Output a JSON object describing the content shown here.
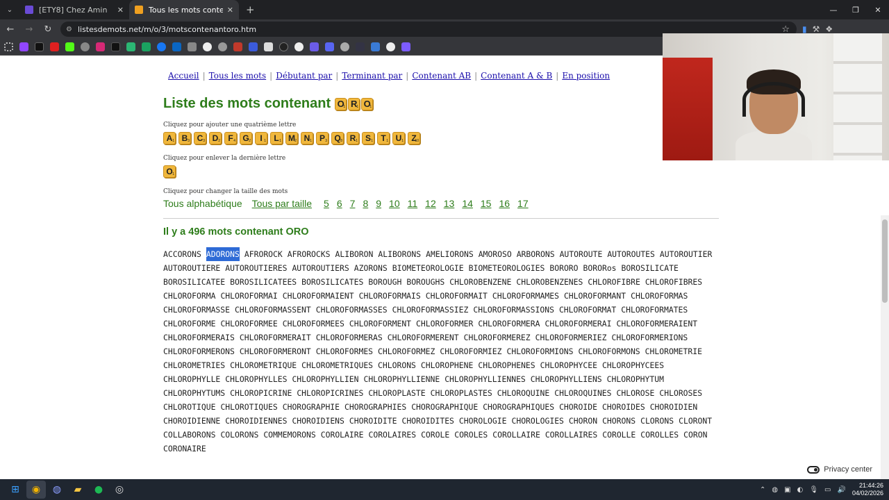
{
  "browser": {
    "tabs": [
      {
        "label": "[ETY8] Chez Amin",
        "color": "#6a4bd6"
      },
      {
        "label": "Tous les mots contenant ORO",
        "color": "#f0a020"
      }
    ],
    "url": "listesdemots.net/m/o/3/motscontenantoro.htm"
  },
  "nav": {
    "items": [
      "Accueil",
      "Tous les mots",
      "Débutant par",
      "Terminant par",
      "Contenant AB",
      "Contenant A & B",
      "En position"
    ]
  },
  "page": {
    "title": "Liste des mots contenant",
    "title_tiles": [
      {
        "l": "O",
        "s": "1"
      },
      {
        "l": "R",
        "s": "1"
      },
      {
        "l": "O",
        "s": "1"
      }
    ],
    "add_hint": "Cliquez pour ajouter une quatrième lettre",
    "add_tiles": [
      {
        "l": "A",
        "s": "1"
      },
      {
        "l": "B",
        "s": "3"
      },
      {
        "l": "C",
        "s": "3"
      },
      {
        "l": "D",
        "s": "2"
      },
      {
        "l": "F",
        "s": "4"
      },
      {
        "l": "G",
        "s": "2"
      },
      {
        "l": "I",
        "s": "1"
      },
      {
        "l": "L",
        "s": "1"
      },
      {
        "l": "M",
        "s": "2"
      },
      {
        "l": "N",
        "s": "1"
      },
      {
        "l": "P",
        "s": "3"
      },
      {
        "l": "Q",
        "s": "8"
      },
      {
        "l": "R",
        "s": "1"
      },
      {
        "l": "S",
        "s": "1"
      },
      {
        "l": "T",
        "s": "1"
      },
      {
        "l": "U",
        "s": "1"
      },
      {
        "l": "Z",
        "s": "10"
      }
    ],
    "remove_hint": "Cliquez pour enlever la dernière lettre",
    "remove_tile": {
      "l": "O",
      "s": "1"
    },
    "size_hint": "Cliquez pour changer la taille des mots",
    "size_alpha": "Tous alphabétique",
    "size_bysize": "Tous par taille",
    "sizes": [
      "5",
      "6",
      "7",
      "8",
      "9",
      "10",
      "11",
      "12",
      "13",
      "14",
      "15",
      "16",
      "17"
    ],
    "count": "Il y a 496 mots contenant ORO",
    "selected_word": "ADORONS",
    "words": [
      "ACCORONS",
      "ADORONS",
      "AFROROCK",
      "AFROROCKS",
      "ALIBORON",
      "ALIBORONS",
      "AMELIORONS",
      "AMOROSO",
      "ARBORONS",
      "AUTOROUTE",
      "AUTOROUTES",
      "AUTOROUTIER",
      "AUTOROUTIERE",
      "AUTOROUTIERES",
      "AUTOROUTIERS",
      "AZORONS",
      "BIOMETEOROLOGIE",
      "BIOMETEOROLOGIES",
      "BORORO",
      "BORORos",
      "BOROSILICATE",
      "BOROSILICATEE",
      "BOROSILICATEES",
      "BOROSILICATES",
      "BOROUGH",
      "BOROUGHS",
      "CHLOROBENZENE",
      "CHLOROBENZENES",
      "CHLOROFIBRE",
      "CHLOROFIBRES",
      "CHLOROFORMA",
      "CHLOROFORMAI",
      "CHLOROFORMAIENT",
      "CHLOROFORMAIS",
      "CHLOROFORMAIT",
      "CHLOROFORMAMES",
      "CHLOROFORMANT",
      "CHLOROFORMAS",
      "CHLOROFORMASSE",
      "CHLOROFORMASSENT",
      "CHLOROFORMASSES",
      "CHLOROFORMASSIEZ",
      "CHLOROFORMASSIONS",
      "CHLOROFORMAT",
      "CHLOROFORMATES",
      "CHLOROFORME",
      "CHLOROFORMEE",
      "CHLOROFORMEES",
      "CHLOROFORMENT",
      "CHLOROFORMER",
      "CHLOROFORMERA",
      "CHLOROFORMERAI",
      "CHLOROFORMERAIENT",
      "CHLOROFORMERAIS",
      "CHLOROFORMERAIT",
      "CHLOROFORMERAS",
      "CHLOROFORMERENT",
      "CHLOROFORMEREZ",
      "CHLOROFORMERIEZ",
      "CHLOROFORMERIONS",
      "CHLOROFORMERONS",
      "CHLOROFORMERONT",
      "CHLOROFORMES",
      "CHLOROFORMEZ",
      "CHLOROFORMIEZ",
      "CHLOROFORMIONS",
      "CHLOROFORMONS",
      "CHLOROMETRIE",
      "CHLOROMETRIES",
      "CHLOROMETRIQUE",
      "CHLOROMETRIQUES",
      "CHLORONS",
      "CHLOROPHENE",
      "CHLOROPHENES",
      "CHLOROPHYCEE",
      "CHLOROPHYCEES",
      "CHLOROPHYLLE",
      "CHLOROPHYLLES",
      "CHLOROPHYLLIEN",
      "CHLOROPHYLLIENNE",
      "CHLOROPHYLLIENNES",
      "CHLOROPHYLLIENS",
      "CHLOROPHYTUM",
      "CHLOROPHYTUMS",
      "CHLOROPICRINE",
      "CHLOROPICRINES",
      "CHLOROPLASTE",
      "CHLOROPLASTES",
      "CHLOROQUINE",
      "CHLOROQUINES",
      "CHLOROSE",
      "CHLOROSES",
      "CHLOROTIQUE",
      "CHLOROTIQUES",
      "CHOROGRAPHIE",
      "CHOROGRAPHIES",
      "CHOROGRAPHIQUE",
      "CHOROGRAPHIQUES",
      "CHOROIDE",
      "CHOROIDES",
      "CHOROIDIEN",
      "CHOROIDIENNE",
      "CHOROIDIENNES",
      "CHOROIDIENS",
      "CHOROIDITE",
      "CHOROIDITES",
      "CHOROLOGIE",
      "CHOROLOGIES",
      "CHORON",
      "CHORONS",
      "CLORONS",
      "CLORONT",
      "COLLABORONS",
      "COLORONS",
      "COMMEMORONS",
      "COROLAIRE",
      "COROLAIRES",
      "COROLE",
      "COROLES",
      "COROLLAIRE",
      "COROLLAIRES",
      "COROLLE",
      "COROLLES",
      "CORON",
      "CORONAIRE"
    ],
    "privacy_label": "Privacy center"
  },
  "taskbar": {
    "time": "21:44:26",
    "date": "04/02/2026"
  }
}
